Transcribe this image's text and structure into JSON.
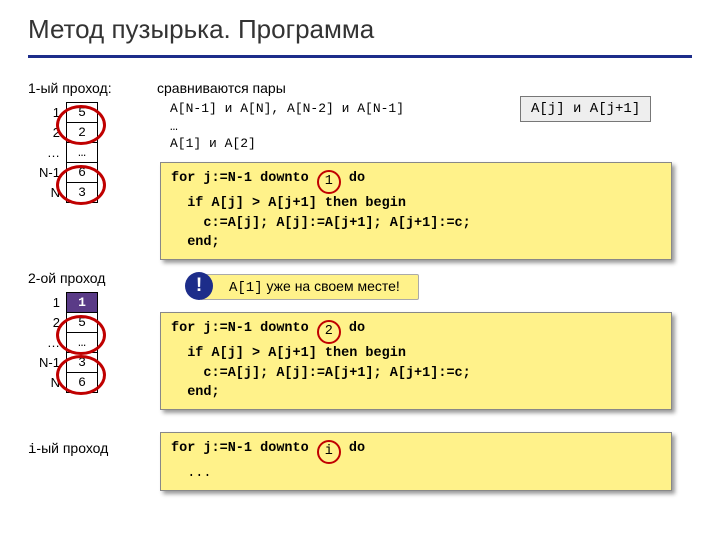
{
  "title": "Метод пузырька. Программа",
  "pass1": {
    "label": "1-ый проход:",
    "indices": [
      "1",
      "2",
      "…",
      "N-1",
      "N"
    ],
    "values": [
      "5",
      "2",
      "…",
      "6",
      "3"
    ],
    "desc_title": "сравниваются пары",
    "desc_line1": "A[N-1] и A[N],   A[N-2] и A[N-1]",
    "desc_dots": "…",
    "desc_line2": "A[1] и A[2]",
    "key": "A[j] и A[j+1]",
    "code_for_a": "for j:=N-1 downto ",
    "code_for_b": " do",
    "circ": "1",
    "code_if": "  if A[j] > A[j+1] then begin",
    "code_swap": "    c:=A[j]; A[j]:=A[j+1]; A[j+1]:=c;",
    "code_end": "  end;"
  },
  "pass2": {
    "label": "2-ой проход",
    "indices": [
      "1",
      "2",
      "…",
      "N-1",
      "N"
    ],
    "values": [
      "1",
      "5",
      "…",
      "3",
      "6"
    ],
    "note_code": "A[1]",
    "note_text": " уже на своем месте!",
    "code_for_a": "for j:=N-1 downto ",
    "code_for_b": " do",
    "circ": "2",
    "code_if": "  if A[j] > A[j+1] then begin",
    "code_swap": "    c:=A[j]; A[j]:=A[j+1]; A[j+1]:=c;",
    "code_end": "  end;"
  },
  "passi": {
    "label_code": "i",
    "label_text": "-ый проход",
    "code_for_a": "for j:=N-1 downto ",
    "code_for_b": " do",
    "circ": "i",
    "code_dots": "  ..."
  }
}
